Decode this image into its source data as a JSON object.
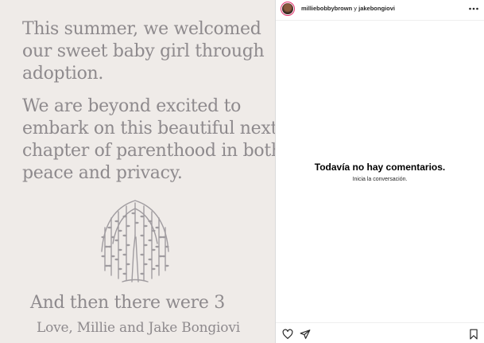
{
  "post": {
    "paragraph_1": [
      "This summer, we welcomed",
      "our sweet baby girl through",
      "adoption."
    ],
    "paragraph_2": [
      "We are beyond excited to",
      "embark on this beautiful next",
      "chapter of parenthood in both",
      "peace and privacy."
    ],
    "closing": "And then there were 3",
    "signature": "Love, Millie and Jake Bongiovi",
    "illustration": "willow-tree",
    "text_color": "#8e8a8d",
    "background_color": "#efebe8"
  },
  "header": {
    "author_1": "milliebobbybrown",
    "separator": "y",
    "author_2": "jakebongiovi",
    "more_icon": "more-icon"
  },
  "comments": {
    "empty_title": "Todavía no hay comentarios.",
    "empty_subtitle": "Inicia la conversación."
  },
  "actions": {
    "icons": [
      "heart-icon",
      "share-icon",
      "bookmark-icon"
    ]
  }
}
